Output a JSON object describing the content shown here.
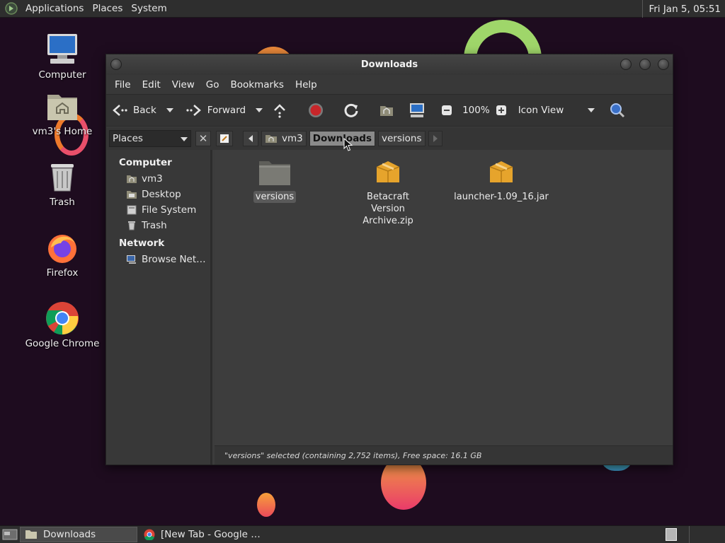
{
  "top_panel": {
    "menu": [
      "Applications",
      "Places",
      "System"
    ],
    "clock": "Fri Jan  5, 05:51"
  },
  "desktop_icons": [
    {
      "label": "Computer",
      "icon": "computer-icon"
    },
    {
      "label": "vm3's Home",
      "icon": "home-folder-icon"
    },
    {
      "label": "Trash",
      "icon": "trash-icon"
    },
    {
      "label": "Firefox",
      "icon": "firefox-icon"
    },
    {
      "label": "Google Chrome",
      "icon": "chrome-icon"
    }
  ],
  "window": {
    "title": "Downloads",
    "menu": [
      "File",
      "Edit",
      "View",
      "Go",
      "Bookmarks",
      "Help"
    ],
    "toolbar": {
      "back": "Back",
      "forward": "Forward",
      "zoom": "100%",
      "view_mode": "Icon View"
    },
    "places_select": "Places",
    "breadcrumbs": [
      "vm3",
      "Downloads",
      "versions"
    ],
    "active_crumb": "Downloads",
    "sidebar": {
      "sections": [
        {
          "heading": "Computer",
          "items": [
            {
              "label": "vm3",
              "icon": "home-icon"
            },
            {
              "label": "Desktop",
              "icon": "desktop-icon"
            },
            {
              "label": "File System",
              "icon": "filesystem-icon"
            },
            {
              "label": "Trash",
              "icon": "trash-icon"
            }
          ]
        },
        {
          "heading": "Network",
          "items": [
            {
              "label": "Browse Net…",
              "icon": "network-icon"
            }
          ]
        }
      ]
    },
    "files": [
      {
        "name": "versions",
        "type": "folder",
        "selected": true
      },
      {
        "name": "Betacraft Version Archive.zip",
        "type": "archive",
        "selected": false
      },
      {
        "name": "launcher-1.09_16.jar",
        "type": "archive",
        "selected": false
      }
    ],
    "status": "\"versions\" selected (containing 2,752 items), Free space: 16.1 GB"
  },
  "taskbar": {
    "tasks": [
      {
        "label": "Downloads",
        "icon": "folder-icon",
        "active": true
      },
      {
        "label": "[New Tab - Google …",
        "icon": "chrome-icon",
        "active": false
      }
    ]
  },
  "colors": {
    "desktop_bg": "#1e0c1f",
    "panel_bg": "#2e2e2e",
    "window_bg": "#3c3c3c",
    "selection": "#5a5a5a",
    "stop_red": "#c8262a",
    "folder_yellow": "#e6a42c"
  }
}
